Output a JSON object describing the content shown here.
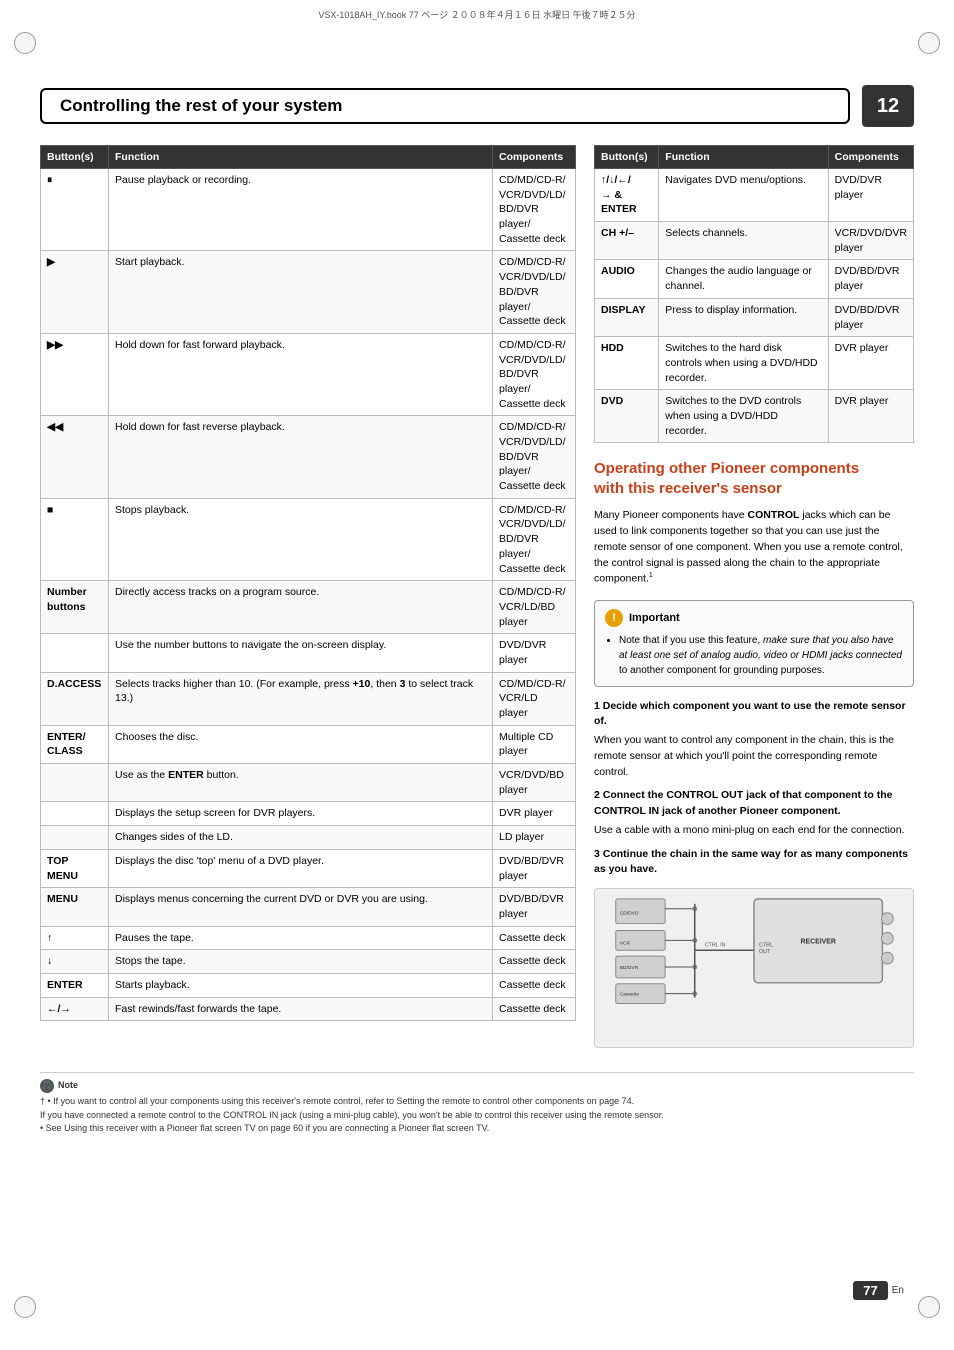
{
  "meta": {
    "file_info": "VSX-1018AH_IY.book  77 ページ  ２００８年４月１６日  水曜日  午後７時２５分",
    "page_number": "77",
    "page_label": "En",
    "chapter": "12"
  },
  "title": "Controlling the rest of your system",
  "left_table": {
    "headers": [
      "Button(s)",
      "Function",
      "Components"
    ],
    "rows": [
      {
        "button": "⏸",
        "function": "Pause playback or recording.",
        "components": "CD/MD/CD-R/\nVCR/DVD/LD/\nBD/DVR\nplayer/\nCassette deck"
      },
      {
        "button": "▶",
        "function": "Start playback.",
        "components": "CD/MD/CD-R/\nVCR/DVD/LD/\nBD/DVR\nplayer/\nCassette deck"
      },
      {
        "button": "▶▶",
        "function": "Hold down for fast forward playback.",
        "components": "CD/MD/CD-R/\nVCR/DVD/LD/\nBD/DVR\nplayer/\nCassette deck"
      },
      {
        "button": "◀◀",
        "function": "Hold down for fast reverse playback.",
        "components": "CD/MD/CD-R/\nVCR/DVD/LD/\nBD/DVR\nplayer/\nCassette deck"
      },
      {
        "button": "■",
        "function": "Stops playback.",
        "components": "CD/MD/CD-R/\nVCR/DVD/LD/\nBD/DVR\nplayer/\nCassette deck"
      },
      {
        "button": "Number\nbuttons",
        "function": "Directly access tracks on a program source.",
        "components": "CD/MD/CD-R/\nVCR/LD/BD\nplayer"
      },
      {
        "button": "",
        "function": "Use the number buttons to navigate the on-screen display.",
        "components": "DVD/DVR\nplayer"
      },
      {
        "button": "D.ACCESS",
        "function": "Selects tracks higher than 10. (For example, press +10, then 3 to select track 13.)",
        "components": "CD/MD/CD-R/\nVCR/LD player"
      },
      {
        "button": "ENTER/\nCLASS",
        "function": "Chooses the disc.",
        "components": "Multiple CD\nplayer"
      },
      {
        "button": "",
        "function": "Use as the ENTER button.",
        "components": "VCR/DVD/BD\nplayer"
      },
      {
        "button": "",
        "function": "Displays the setup screen for DVR players.",
        "components": "DVR player"
      },
      {
        "button": "",
        "function": "Changes sides of the LD.",
        "components": "LD player"
      },
      {
        "button": "TOP MENU",
        "function": "Displays the disc 'top' menu of a DVD player.",
        "components": "DVD/BD/DVR\nplayer"
      },
      {
        "button": "MENU",
        "function": "Displays menus concerning the current DVD or DVR you are using.",
        "components": "DVD/BD/DVR\nplayer"
      },
      {
        "button": "↑",
        "function": "Pauses the tape.",
        "components": "Cassette deck"
      },
      {
        "button": "↓",
        "function": "Stops the tape.",
        "components": "Cassette deck"
      },
      {
        "button": "ENTER",
        "function": "Starts playback.",
        "components": "Cassette deck"
      },
      {
        "button": "←/→",
        "function": "Fast rewinds/fast forwards the tape.",
        "components": "Cassette deck"
      }
    ]
  },
  "right_table": {
    "headers": [
      "Button(s)",
      "Function",
      "Components"
    ],
    "rows": [
      {
        "button": "↑/↓/←/\n→ & ENTER",
        "function": "Navigates DVD menu/options.",
        "components": "DVD/DVR\nplayer"
      },
      {
        "button": "CH +/–",
        "function": "Selects channels.",
        "components": "VCR/DVD/DVR\nplayer"
      },
      {
        "button": "AUDIO",
        "function": "Changes the audio language or channel.",
        "components": "DVD/BD/DVR\nplayer"
      },
      {
        "button": "DISPLAY",
        "function": "Press to display information.",
        "components": "DVD/BD/DVR\nplayer"
      },
      {
        "button": "HDD",
        "function": "Switches to the hard disk controls when using a DVD/HDD recorder.",
        "components": "DVR player"
      },
      {
        "button": "DVD",
        "function": "Switches to the DVD controls when using a DVD/HDD recorder.",
        "components": "DVR player"
      }
    ]
  },
  "operating_section": {
    "title": "Operating other Pioneer components\nwith this receiver's sensor",
    "body": "Many Pioneer components have CONTROL jacks which can be used to link components together so that you can use just the remote sensor of one component. When you use a remote control, the control signal is passed along the chain to the appropriate component.",
    "footnote": "1"
  },
  "important_box": {
    "header": "Important",
    "icon_label": "!",
    "bullet": "Note that if you use this feature, make sure that you also have at least one set of analog audio, video or HDMI jacks connected to another component for grounding purposes."
  },
  "steps": [
    {
      "number": "1",
      "header": "Decide which component you want to use the remote sensor of.",
      "body": "When you want to control any component in the chain, this is the remote sensor at which you'll point the corresponding remote control."
    },
    {
      "number": "2",
      "header": "Connect the CONTROL OUT jack of that component to the CONTROL IN jack of another Pioneer component.",
      "body": "Use a cable with a mono mini-plug on each end for the connection."
    },
    {
      "number": "3",
      "header": "Continue the chain in the same way for as many components as you have.",
      "body": ""
    }
  ],
  "note_section": {
    "icon_label": "Note",
    "footnote1": "† • If you want to control all your components using this receiver's remote control, refer to Setting the remote to control other components on page 74.",
    "footnote2": "If you have connected a remote control to the CONTROL IN jack (using a mini-plug cable), you won't be able to control this receiver using the remote sensor.",
    "footnote3": "• See Using this receiver with a Pioneer flat screen TV on page 60 if you are connecting a Pioneer flat screen TV."
  }
}
